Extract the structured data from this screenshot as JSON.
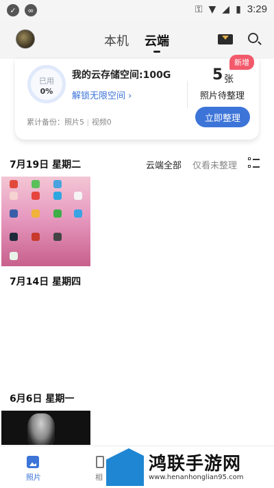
{
  "statusbar": {
    "time": "3:29"
  },
  "topbar": {
    "tab_local": "本机",
    "tab_cloud": "云端"
  },
  "storage_card": {
    "used_label": "已用",
    "used_percent": "0%",
    "title": "我的云存储空间:100G",
    "unlock_link": "解锁无限空间 ›",
    "backup_prefix": "累计备份：",
    "backup_photos": "照片5",
    "backup_videos": "视频0",
    "new_badge": "新增",
    "pending_count": "5",
    "pending_unit": "张",
    "pending_label": "照片待整理",
    "organize_button": "立即整理"
  },
  "filters": {
    "all": "云端全部",
    "unorganized": "仅看未整理"
  },
  "dates": [
    "7月19日 星期二",
    "7月14日 星期四",
    "6月6日 星期一"
  ],
  "bottom_nav": {
    "photos": "照片",
    "album": "相"
  },
  "watermark": {
    "title": "鸿联手游网",
    "url": "www.henanhonglian95.com"
  },
  "colors": {
    "accent": "#3d74d8",
    "badge": "#f25a6c"
  }
}
